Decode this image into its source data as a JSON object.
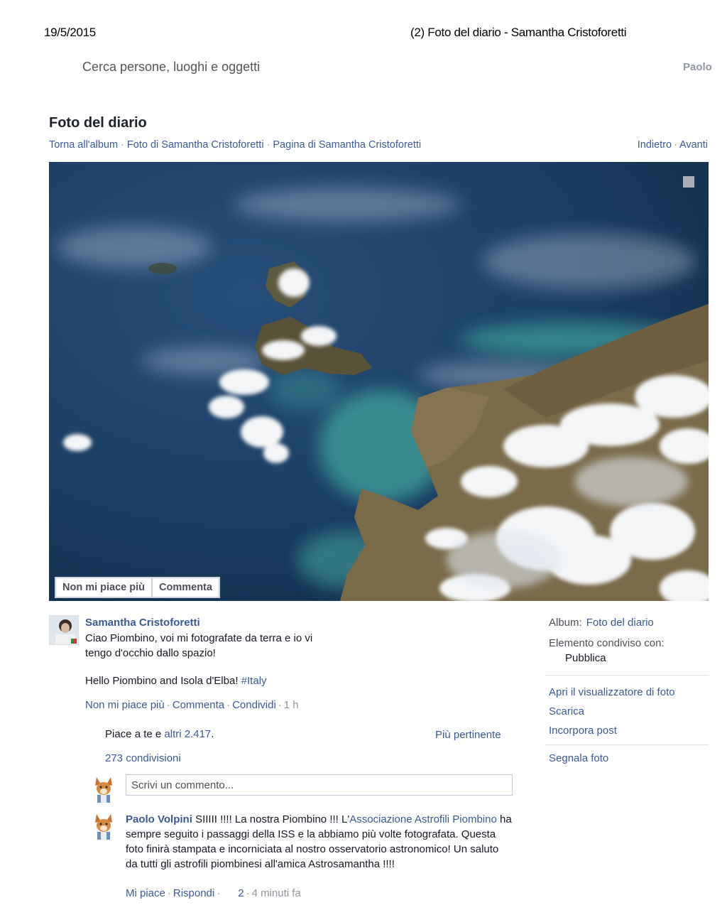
{
  "print_header": {
    "date": "19/5/2015",
    "title": "(2) Foto del diario - Samantha Cristoforetti"
  },
  "topbar": {
    "search_placeholder": "Cerca persone, luoghi e oggetti",
    "user_name": "Paolo"
  },
  "page": {
    "title": "Foto del diario",
    "breadcrumbs": [
      "Torna all'album",
      "Foto di Samantha Cristoforetti",
      "Pagina di Samantha Cristoforetti"
    ],
    "prev_label": "Indietro",
    "next_label": "Avanti"
  },
  "photo_actions": {
    "unlike_label": "Non mi piace più",
    "comment_label": "Commenta"
  },
  "post": {
    "author": "Samantha Cristoforetti",
    "text_it": "Ciao Piombino, voi mi fotografate da terra e io vi tengo d'occhio dallo spazio!",
    "text_en": "Hello Piombino and Isola d'Elba!",
    "hashtag": "#Italy",
    "actions": {
      "unlike": "Non mi piace più",
      "comment": "Commenta",
      "share": "Condividi",
      "time": "1 h"
    },
    "likes_prefix": "Piace a te e",
    "likes_others": "altri 2.417",
    "likes_suffix": ".",
    "sort_label": "Più pertinente",
    "shares": "273 condivisioni",
    "comment_placeholder": "Scrivi un commento..."
  },
  "comment": {
    "author": "Paolo Volpini",
    "text_before": "SIIIII !!!! La nostra Piombino !!! L'",
    "mention": "Associazione Astrofili Piombino",
    "text_after": "ha sempre seguito i passaggi della ISS e la abbiamo più volte fotografata. Questa foto finirà stampata e incorniciata al nostro osservatorio astronomico! Un saluto da tutti gli astrofili piombinesi all'amica Astrosamantha !!!!",
    "like_label": "Mi piace",
    "reply_label": "Rispondi",
    "like_count": "2",
    "time": "4 minuti fa"
  },
  "sidebar": {
    "album_label": "Album:",
    "album_link": "Foto del diario",
    "shared_label": "Elemento condiviso con:",
    "shared_value": "Pubblica",
    "links": [
      "Apri il visualizzatore di foto",
      "Scarica",
      "Incorpora post"
    ],
    "report_link": "Segnala foto"
  },
  "colors": {
    "link": "#3b5998",
    "text": "#141823",
    "muted": "#90949c",
    "sea": "#1a3a5e",
    "coastal_water": "#3e9c9a",
    "land": "#7a6a48"
  },
  "icons": [
    "enlarge-square-icon",
    "author-avatar",
    "fox-avatar-icon"
  ]
}
